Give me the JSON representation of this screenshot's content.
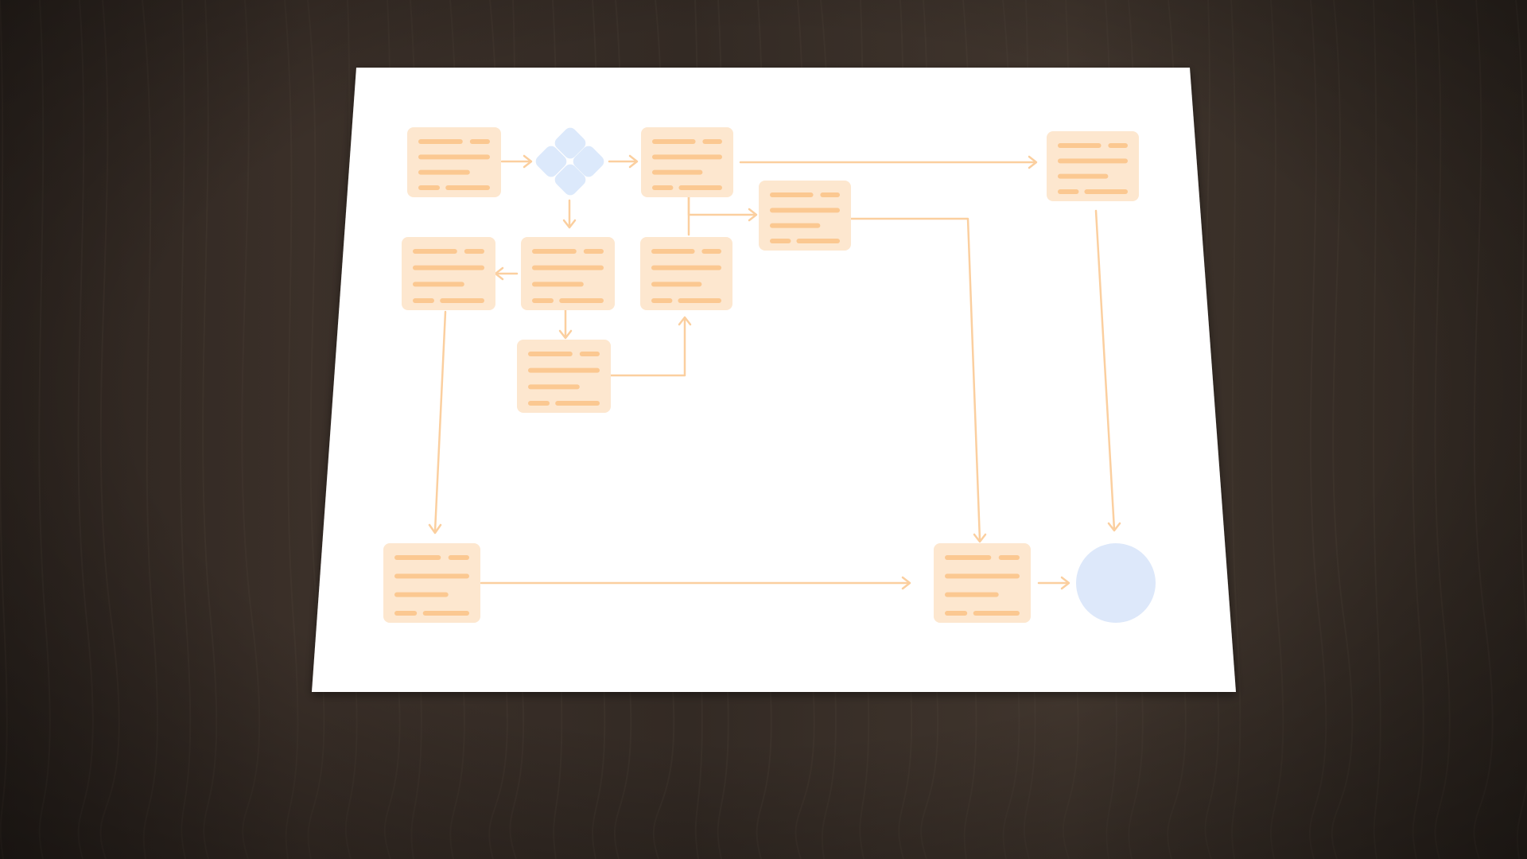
{
  "colors": {
    "wood_base": "#3a3029",
    "wood_dark": "#2a221d",
    "wood_light": "#4a3e36",
    "paper": "#ffffff",
    "node_fill": "#fde7cf",
    "node_line": "#fbc891",
    "connector": "#fbcf9f",
    "decision_fill": "#dce9fb",
    "terminal_fill": "#dde8fa"
  },
  "diagram": {
    "node_count": 12,
    "decision_count": 1,
    "terminal_count": 1
  }
}
